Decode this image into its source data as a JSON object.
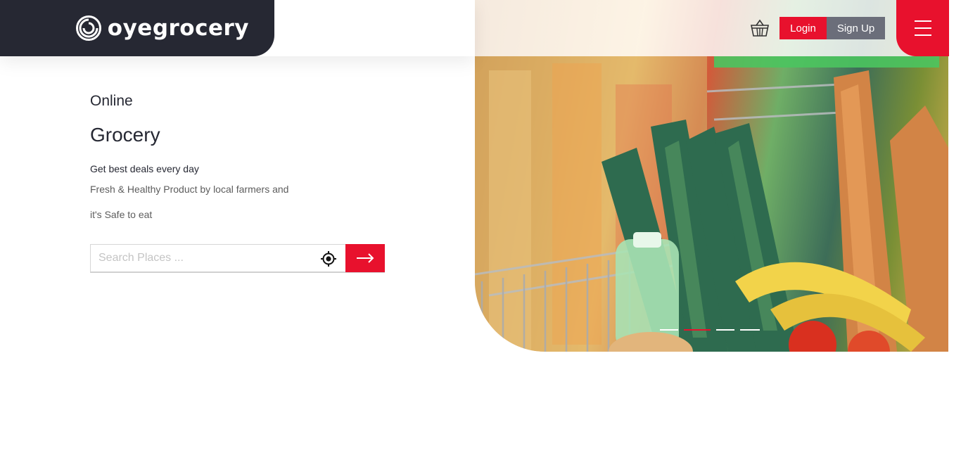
{
  "brand": {
    "name": "oyegrocery",
    "logo_icon": "swirl-logo-icon"
  },
  "header": {
    "cart_icon": "basket-icon",
    "login_label": "Login",
    "signup_label": "Sign Up",
    "menu_icon": "hamburger-menu-icon"
  },
  "hero": {
    "eyebrow": "Online",
    "title": "Grocery",
    "tagline": "Get best deals every day",
    "description_line1": "Fresh & Healthy Product by local farmers and",
    "description_line2": "it's Safe to eat"
  },
  "search": {
    "placeholder": "Search Places ...",
    "value": "",
    "locate_icon": "crosshair-locate-icon",
    "submit_icon": "arrow-right-icon"
  },
  "slider": {
    "slide_count": 4,
    "active_index": 1
  },
  "colors": {
    "brand_dark": "#262833",
    "accent_red": "#e8112d",
    "secondary_gray": "#6b6e7a"
  }
}
